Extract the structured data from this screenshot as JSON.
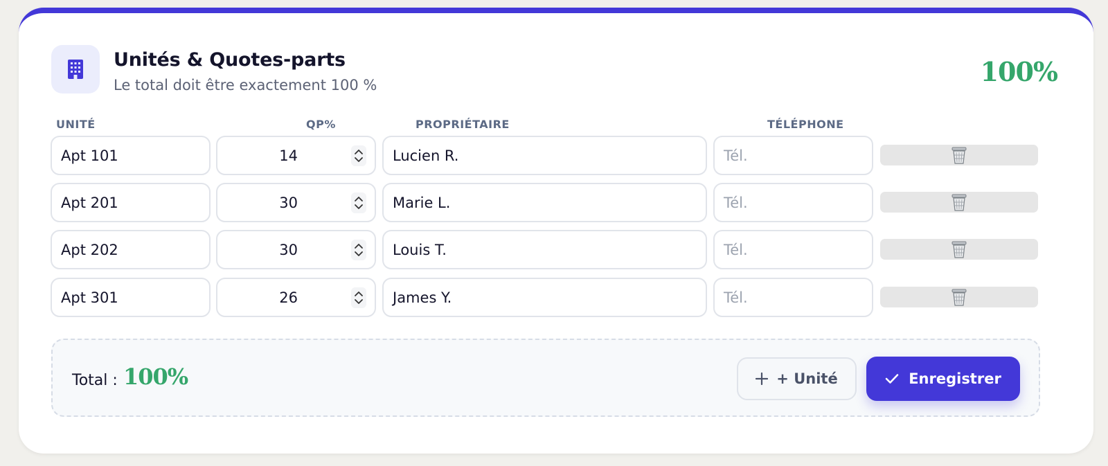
{
  "header": {
    "title": "Unités & Quotes-parts",
    "subtitle": "Le total doit être exactement 100 %",
    "total": "100%",
    "icon": "building-icon"
  },
  "columns": {
    "unit": "UNITÉ",
    "qp": "QP%",
    "owner": "PROPRIÉTAIRE",
    "phone": "TÉLÉPHONE"
  },
  "rows": [
    {
      "unit": "Apt 101",
      "qp": "14",
      "owner": "Lucien R.",
      "phone": "",
      "phone_placeholder": "Tél."
    },
    {
      "unit": "Apt 201",
      "qp": "30",
      "owner": "Marie L.",
      "phone": "",
      "phone_placeholder": "Tél."
    },
    {
      "unit": "Apt 202",
      "qp": "30",
      "owner": "Louis T.",
      "phone": "",
      "phone_placeholder": "Tél."
    },
    {
      "unit": "Apt 301",
      "qp": "26",
      "owner": "James Y.",
      "phone": "",
      "phone_placeholder": "Tél."
    }
  ],
  "footer": {
    "total_label": "Total :",
    "total_value": "100%",
    "add_label": "+ Unité",
    "save_label": "Enregistrer"
  },
  "colors": {
    "accent": "#4338d8",
    "success": "#35a66b",
    "icon_bg": "#ebedfc"
  }
}
